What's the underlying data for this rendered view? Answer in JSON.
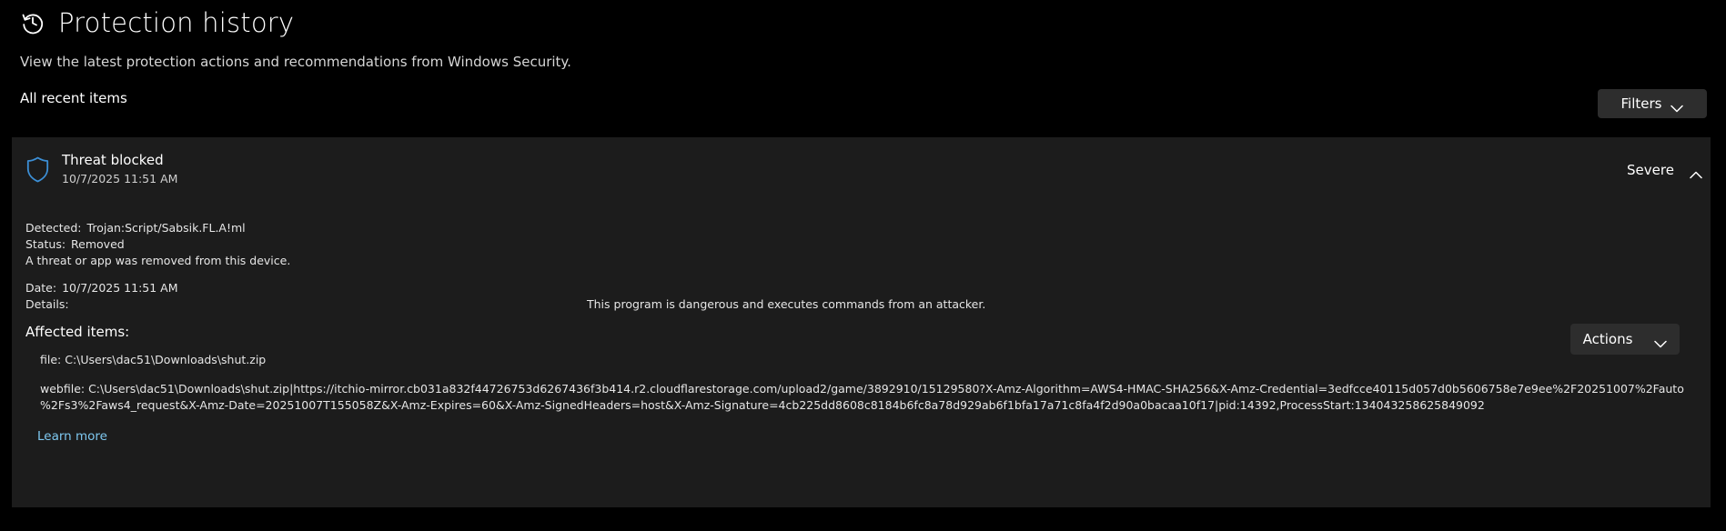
{
  "header": {
    "title": "Protection history",
    "subtitle": "View the latest protection actions and recommendations from Windows Security.",
    "section_label": "All recent items",
    "filters_label": "Filters"
  },
  "card": {
    "title": "Threat blocked",
    "date": "10/7/2025 11:51 AM",
    "severity": "Severe",
    "detected_label": "Detected:",
    "detected_value": "Trojan:Script/Sabsik.FL.A!ml",
    "status_label": "Status:",
    "status_value": "Removed",
    "removed_note": "A threat or app was removed from this device.",
    "date_label": "Date:",
    "date_value": "10/7/2025 11:51 AM",
    "details_label": "Details:",
    "details_value": "This program is dangerous and executes commands from an attacker.",
    "affected_title": "Affected items:",
    "affected_items": [
      "file: C:\\Users\\dac51\\Downloads\\shut.zip",
      "webfile: C:\\Users\\dac51\\Downloads\\shut.zip|https://itchio-mirror.cb031a832f44726753d6267436f3b414.r2.cloudflarestorage.com/upload2/game/3892910/15129580?X-Amz-Algorithm=AWS4-HMAC-SHA256&X-Amz-Credential=3edfcce40115d057d0b5606758e7e9ee%2F20251007%2Fauto",
      "%2Fs3%2Faws4_request&X-Amz-Date=20251007T155058Z&X-Amz-Expires=60&X-Amz-SignedHeaders=host&X-Amz-Signature=4cb225dd8608c8184b6fc8a78d929ab6f1bfa17a71c8fa4f2d90a0bacaa10f17|pid:14392,ProcessStart:134043258625849092"
    ],
    "learn_more": "Learn more",
    "actions_label": "Actions"
  },
  "icons": {
    "history": "history-icon",
    "shield": "shield-icon",
    "filters_chevron": "chevron-down-icon",
    "collapse": "chevron-up-icon",
    "actions_chevron": "chevron-down-icon"
  },
  "colors": {
    "background": "#000000",
    "card": "#1c1c1c",
    "button": "#2d2d2d",
    "shield": "#3c8fd6",
    "link": "#7ec8f0"
  }
}
